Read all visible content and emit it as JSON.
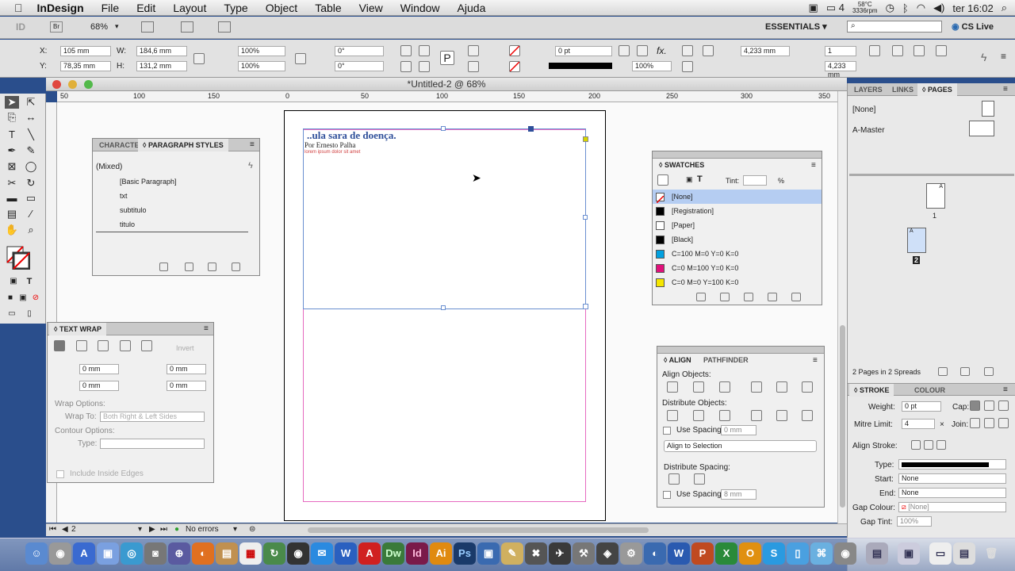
{
  "menubar": {
    "app": "InDesign",
    "items": [
      "File",
      "Edit",
      "Layout",
      "Type",
      "Object",
      "Table",
      "View",
      "Window",
      "Ajuda"
    ],
    "battery": "4",
    "temp": "58°C",
    "rpm": "3336rpm",
    "clock": "ter 16:02"
  },
  "appbar": {
    "zoom": "68%",
    "workspace": "ESSENTIALS ▾",
    "cslive": "CS Live",
    "br": "Br"
  },
  "control": {
    "x": "105 mm",
    "y": "78,35 mm",
    "w": "184,6 mm",
    "h": "131,2 mm",
    "scale_x": "100%",
    "scale_y": "100%",
    "rot": "0°",
    "shear": "0°",
    "stroke_w": "0 pt",
    "opacity": "100%",
    "dim1": "4,233 mm",
    "cols": "1",
    "dim2": "4,233 mm"
  },
  "document": {
    "title": "*Untitled-2 @ 68%",
    "heading": "..ula sara de doença.",
    "byline": "Por Ernesto Palha",
    "body": "lorem ipsum dolor sit amet"
  },
  "ruler": {
    "ticks": [
      "50",
      "0",
      "50",
      "100",
      "150",
      "200",
      "250",
      "300",
      "350"
    ],
    "labels": [
      "100",
      "150"
    ]
  },
  "styles": {
    "tab1": "CHARACTE",
    "tab2": "PARAGRAPH STYLES",
    "current": "(Mixed)",
    "items": [
      "[Basic Paragraph]",
      "txt",
      "subtitulo",
      "titulo"
    ]
  },
  "textwrap": {
    "title": "TEXT WRAP",
    "invert": "Invert",
    "top": "0 mm",
    "bottom": "0 mm",
    "left": "0 mm",
    "right": "0 mm",
    "wrap_opts": "Wrap Options:",
    "wrap_to_lbl": "Wrap To:",
    "wrap_to": "Both Right & Left Sides",
    "contour": "Contour Options:",
    "type_lbl": "Type:",
    "include": "Include Inside Edges"
  },
  "swatches": {
    "title": "SWATCHES",
    "tint_lbl": "Tint:",
    "tint_unit": "%",
    "items": [
      {
        "name": "[None]",
        "color": "#ffffff"
      },
      {
        "name": "[Registration]",
        "color": "#000000"
      },
      {
        "name": "[Paper]",
        "color": "#ffffff"
      },
      {
        "name": "[Black]",
        "color": "#000000"
      },
      {
        "name": "C=100 M=0 Y=0 K=0",
        "color": "#00a0e0"
      },
      {
        "name": "C=0 M=100 Y=0 K=0",
        "color": "#e0107a"
      },
      {
        "name": "C=0 M=0 Y=100 K=0",
        "color": "#f5e600"
      }
    ]
  },
  "align": {
    "tab1": "ALIGN",
    "tab2": "PATHFINDER",
    "objects": "Align Objects:",
    "distribute": "Distribute Objects:",
    "use_spacing": "Use Spacing",
    "spacing_val": "0 mm",
    "align_to": "Align to Selection",
    "dist_spacing": "Distribute Spacing:",
    "use_spacing2": "Use Spacing",
    "spacing_val2": "8 mm"
  },
  "pages": {
    "tabs": [
      "LAYERS",
      "LINKS",
      "PAGES"
    ],
    "none": "[None]",
    "master": "A-Master",
    "page1": "1",
    "page2": "2",
    "summary": "2 Pages in 2 Spreads"
  },
  "stroke": {
    "tab1": "STROKE",
    "tab2": "COLOUR",
    "weight_lbl": "Weight:",
    "weight": "0 pt",
    "cap_lbl": "Cap:",
    "mitre_lbl": "Mitre Limit:",
    "mitre": "4",
    "join_lbl": "Join:",
    "align_lbl": "Align Stroke:",
    "type_lbl": "Type:",
    "start_lbl": "Start:",
    "start": "None",
    "end_lbl": "End:",
    "end": "None",
    "gapc_lbl": "Gap Colour:",
    "gapc": "[None]",
    "gapt_lbl": "Gap Tint:",
    "gapt": "100%"
  },
  "status": {
    "page": "2",
    "errors": "No errors"
  }
}
